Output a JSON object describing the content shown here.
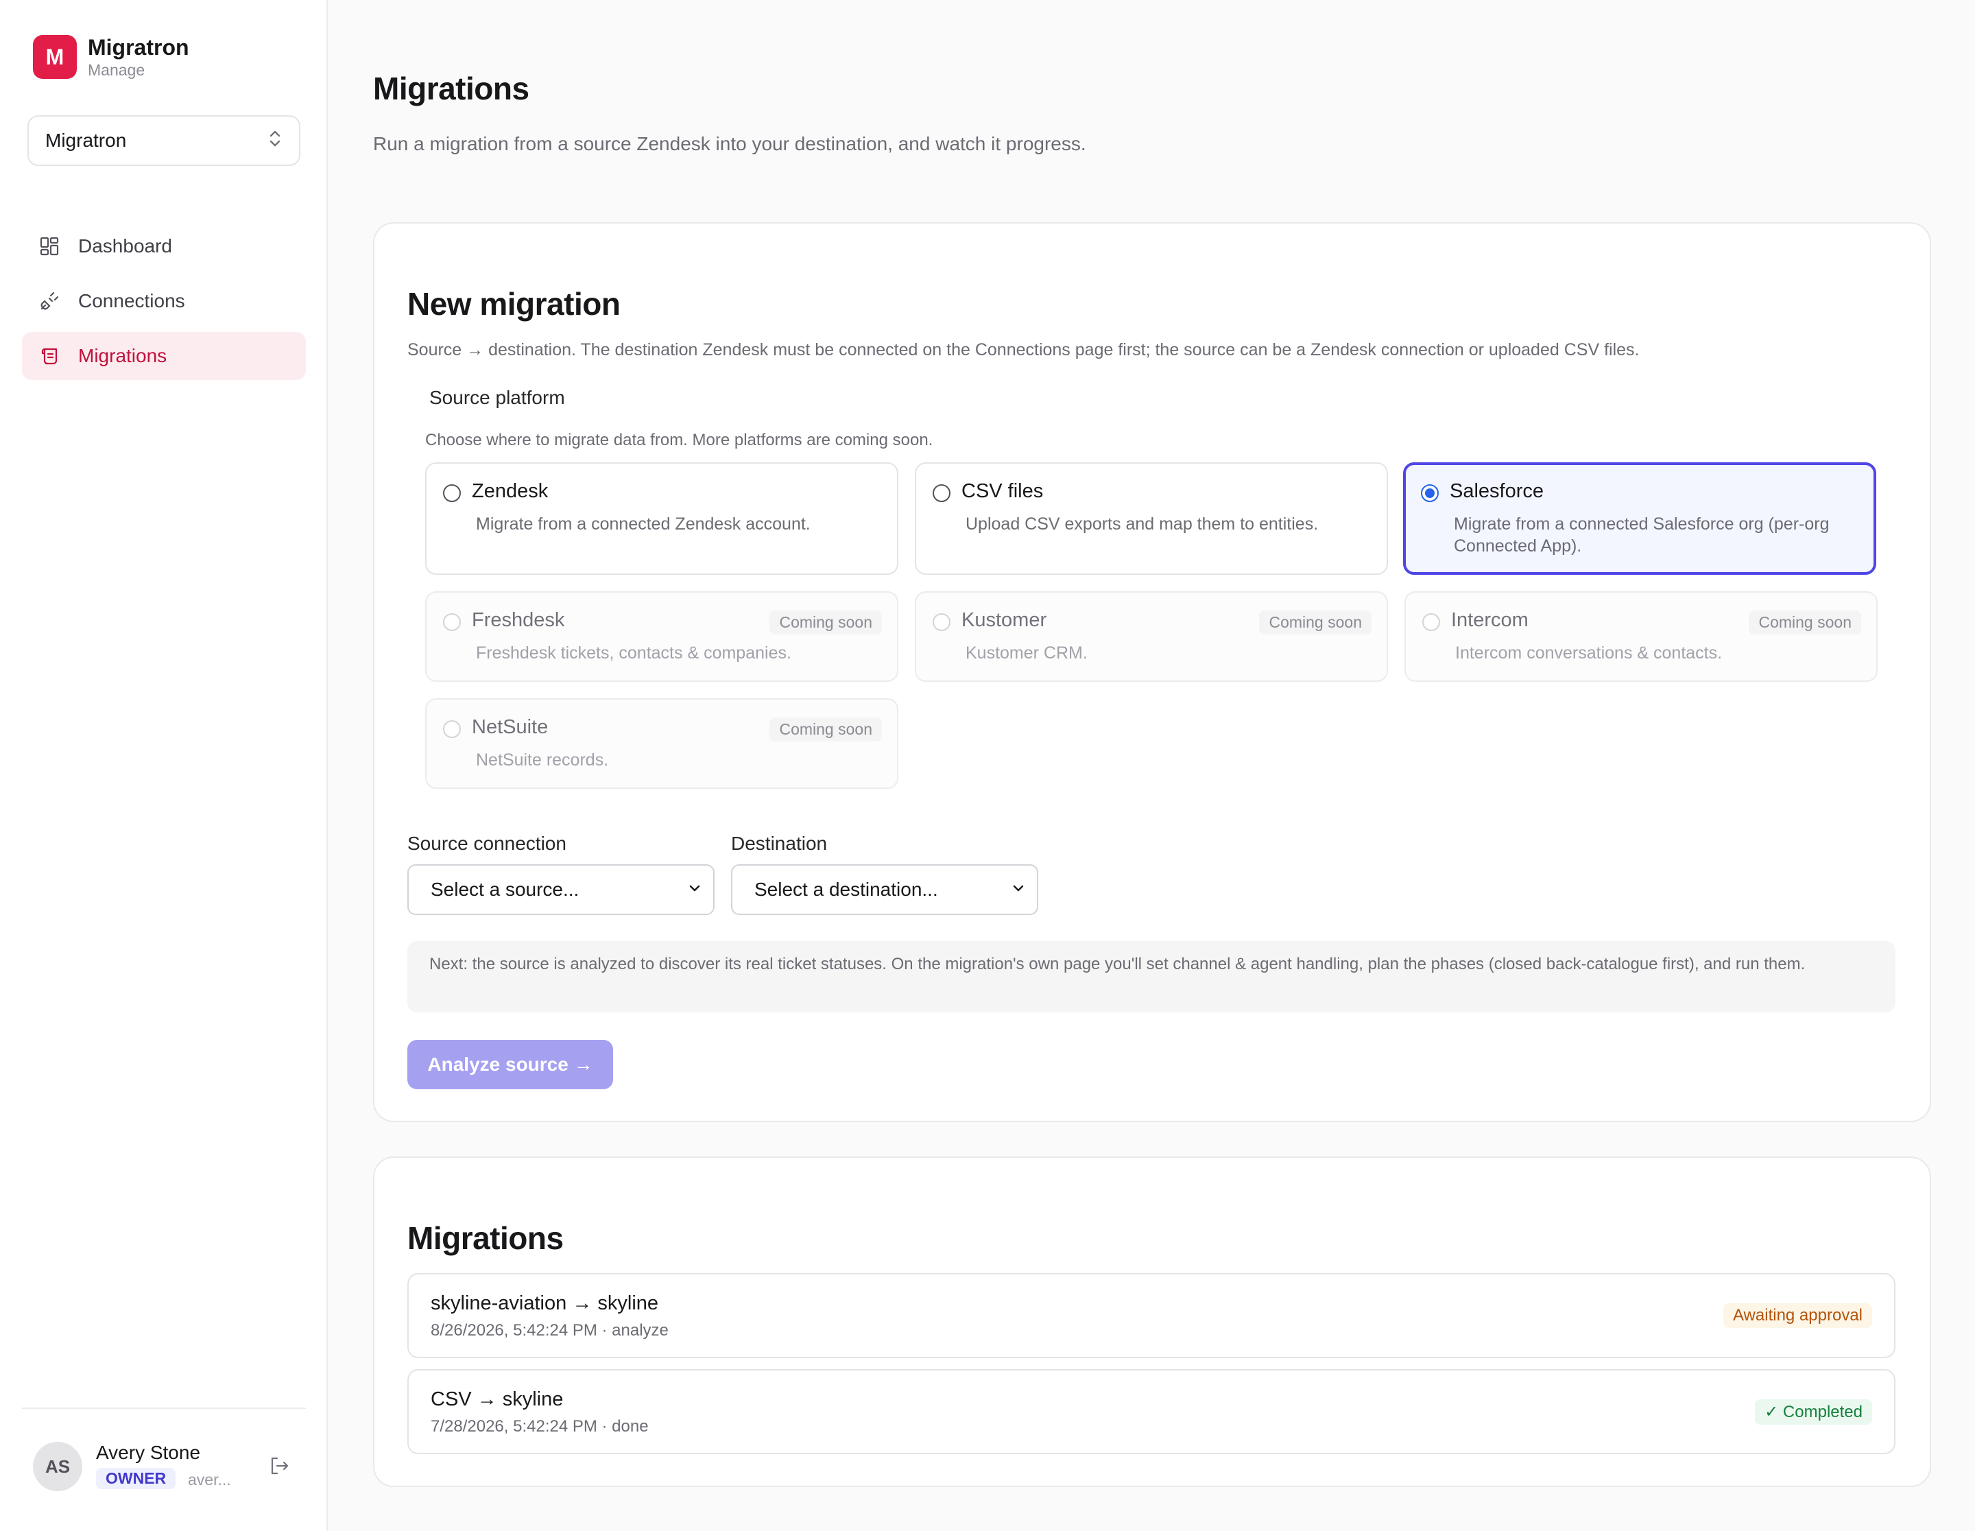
{
  "app": {
    "logo_letter": "M",
    "name": "Migratron",
    "subtitle": "Manage"
  },
  "org_selector": {
    "value": "Migratron"
  },
  "nav": {
    "items": [
      {
        "label": "Dashboard",
        "icon": "dashboard-icon"
      },
      {
        "label": "Connections",
        "icon": "plug-icon"
      },
      {
        "label": "Migrations",
        "icon": "scroll-icon",
        "active": true
      }
    ]
  },
  "user": {
    "initials": "AS",
    "name": "Avery Stone",
    "role": "OWNER",
    "email": "aver..."
  },
  "page": {
    "title": "Migrations",
    "subtitle": "Run a migration from a source Zendesk into your destination, and watch it progress."
  },
  "new_migration": {
    "title": "New migration",
    "description": "Source → destination. The destination Zendesk must be connected on the Connections page first; the source can be a Zendesk connection or uploaded CSV files.",
    "source_platform_label": "Source platform",
    "source_platform_help": "Choose where to migrate data from. More platforms are coming soon.",
    "platforms": [
      {
        "name": "Zendesk",
        "desc": "Migrate from a connected Zendesk account."
      },
      {
        "name": "CSV files",
        "desc": "Upload CSV exports and map them to entities."
      },
      {
        "name": "Salesforce",
        "desc": "Migrate from a connected Salesforce org (per-org Connected App).",
        "selected": true
      },
      {
        "name": "Freshdesk",
        "desc": "Freshdesk tickets, contacts & companies.",
        "badge": "Coming soon"
      },
      {
        "name": "Kustomer",
        "desc": "Kustomer CRM.",
        "badge": "Coming soon"
      },
      {
        "name": "Intercom",
        "desc": "Intercom conversations & contacts.",
        "badge": "Coming soon"
      },
      {
        "name": "NetSuite",
        "desc": "NetSuite records.",
        "badge": "Coming soon"
      }
    ],
    "source_connection_label": "Source connection",
    "source_connection_value": "Select a source...",
    "destination_label": "Destination",
    "destination_value": "Select a destination...",
    "next_note": "Next: the source is analyzed to discover its real ticket statuses. On the migration's own page you'll set channel & agent handling, plan the phases (closed back-catalogue first), and run them.",
    "analyze_button": "Analyze source →"
  },
  "migrations": {
    "title": "Migrations",
    "rows": [
      {
        "title": "skyline-aviation → skyline",
        "meta": "8/26/2026, 5:42:24 PM · analyze",
        "status": "Awaiting approval"
      },
      {
        "title": "CSV → skyline",
        "meta": "7/28/2026, 5:42:24 PM · done",
        "status": "✓ Completed"
      }
    ]
  },
  "colors": {
    "brand": "#e11d48",
    "accent": "#4f46e5",
    "active_nav": "#be123c"
  }
}
